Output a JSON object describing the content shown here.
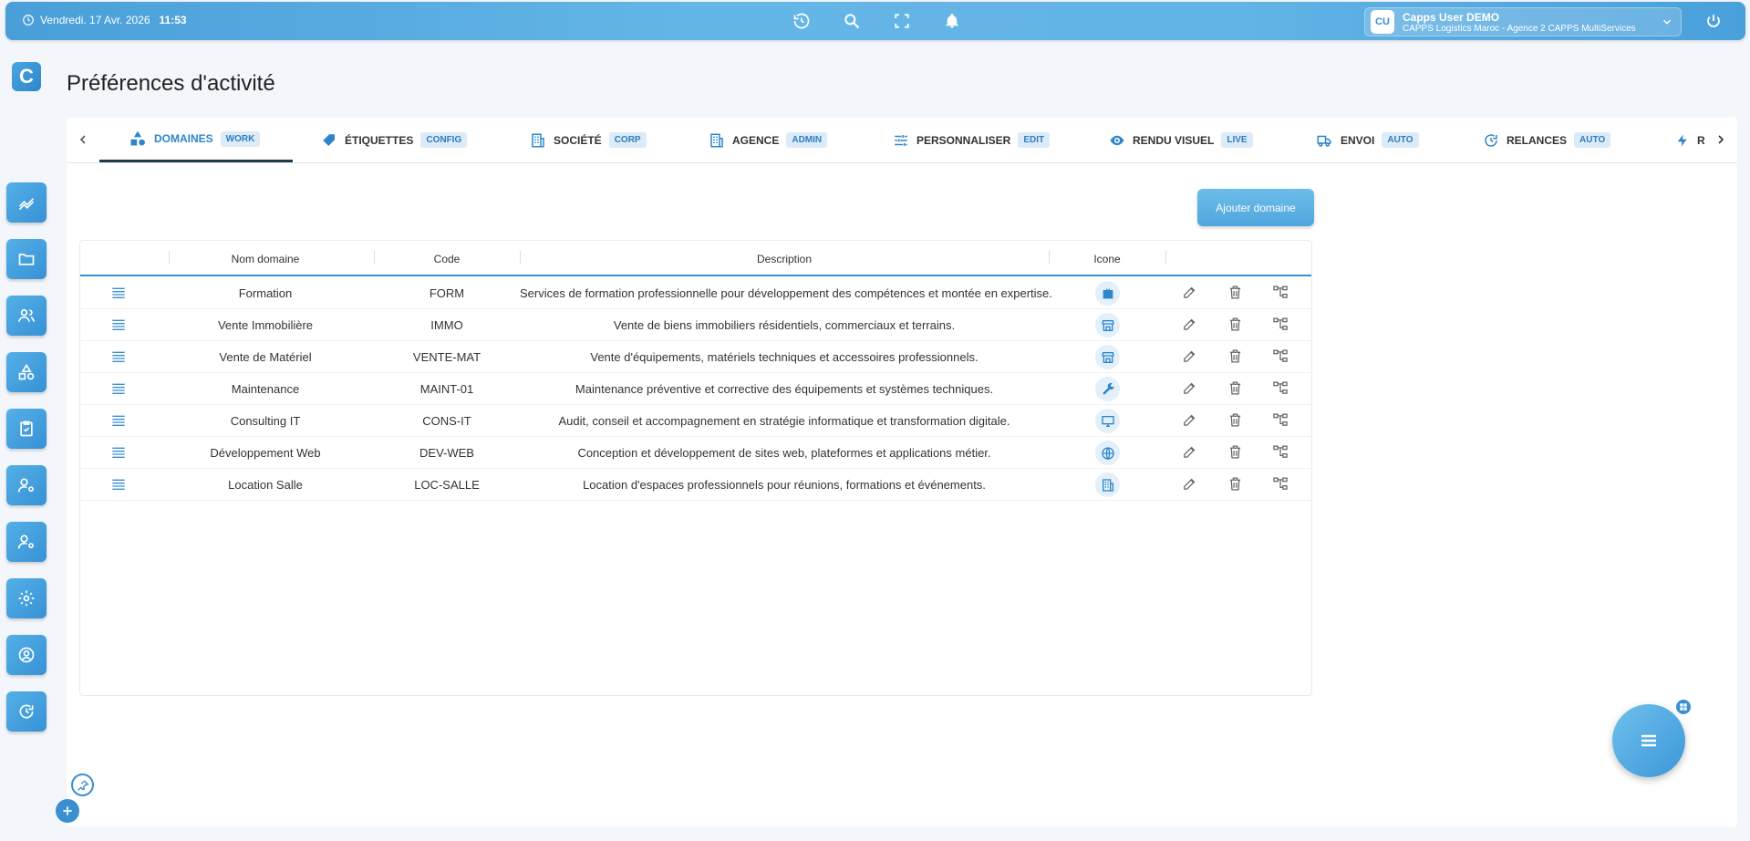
{
  "topbar": {
    "date": "Vendredi. 17 Avr. 2026",
    "time": "11:53",
    "user_initials": "CU",
    "user_name": "Capps User DEMO",
    "user_org": "CAPPS Logistics Maroc - Agence 2 CAPPS MultiServices"
  },
  "logo_letter": "C",
  "page_title": "Préférences d'activité",
  "tabs": [
    {
      "label": "DOMAINES",
      "badge": "WORK"
    },
    {
      "label": "ÉTIQUETTES",
      "badge": "CONFIG"
    },
    {
      "label": "SOCIÉTÉ",
      "badge": "CORP"
    },
    {
      "label": "AGENCE",
      "badge": "ADMIN"
    },
    {
      "label": "PERSONNALISER",
      "badge": "EDIT"
    },
    {
      "label": "RENDU VISUEL",
      "badge": "LIVE"
    },
    {
      "label": "ENVOI",
      "badge": "AUTO"
    },
    {
      "label": "RELANCES",
      "badge": "AUTO"
    },
    {
      "label": "R",
      "badge": ""
    }
  ],
  "add_button": "Ajouter domaine",
  "table": {
    "headers": [
      "Nom domaine",
      "Code",
      "Description",
      "Icone"
    ],
    "rows": [
      {
        "name": "Formation",
        "code": "FORM",
        "description": "Services de formation professionnelle pour développement des compétences et montée en expertise.",
        "icon": "briefcase-icon"
      },
      {
        "name": "Vente Immobilière",
        "code": "IMMO",
        "description": "Vente de biens immobiliers résidentiels, commerciaux et terrains.",
        "icon": "store-icon"
      },
      {
        "name": "Vente de Matériel",
        "code": "VENTE-MAT",
        "description": "Vente d'équipements, matériels techniques et accessoires professionnels.",
        "icon": "store-icon"
      },
      {
        "name": "Maintenance",
        "code": "MAINT-01",
        "description": "Maintenance préventive et corrective des équipements et systèmes techniques.",
        "icon": "wrench-icon"
      },
      {
        "name": "Consulting IT",
        "code": "CONS-IT",
        "description": "Audit, conseil et accompagnement en stratégie informatique et transformation digitale.",
        "icon": "monitor-icon"
      },
      {
        "name": "Développement Web",
        "code": "DEV-WEB",
        "description": "Conception et développement de sites web, plateformes et applications métier.",
        "icon": "globe-icon"
      },
      {
        "name": "Location Salle",
        "code": "LOC-SALLE",
        "description": "Location d'espaces professionnels pour réunions, formations et événements.",
        "icon": "building-icon"
      }
    ]
  },
  "colors": {
    "accent": "#3a8fd0",
    "topbar": "#5fb1e4"
  }
}
